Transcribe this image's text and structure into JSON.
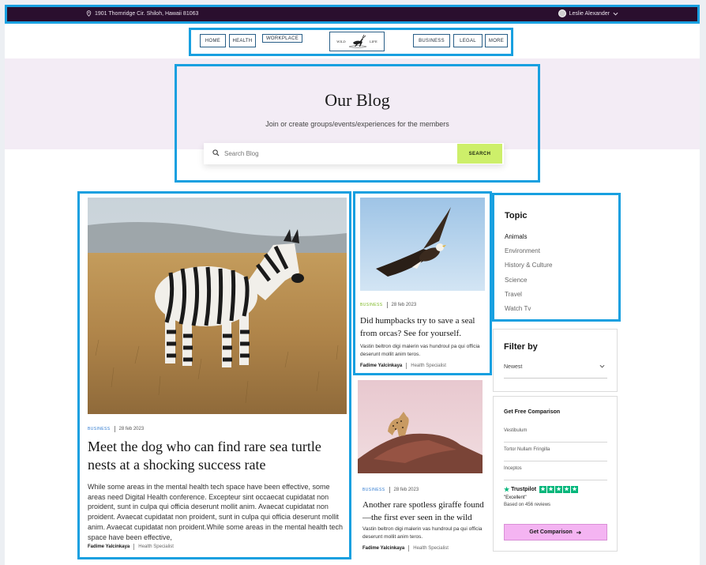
{
  "topbar": {
    "address": "1901 Thornridge Cir. Shiloh, Hawaii 81063",
    "user_name": "Leslie Alexander"
  },
  "nav": {
    "left": [
      "HOME",
      "HEALTH",
      "WORKPLACE"
    ],
    "right": [
      "BUSINESS",
      "LEGAL",
      "MORE"
    ],
    "logo_left": "WILD",
    "logo_right": "LIFE"
  },
  "hero": {
    "title": "Our Blog",
    "subtitle": "Join or create groups/events/experiences for the members",
    "search_placeholder": "Search Blog",
    "search_button": "SEARCH"
  },
  "posts": [
    {
      "category": "BUSINESS",
      "date": "28 feb 2023",
      "title": "Meet the dog who can find rare sea turtle nests at a shocking success rate",
      "excerpt": "While some areas in the mental health tech space have been effective, some areas need Digital Health conference. Excepteur sint occaecat cupidatat non proident, sunt in culpa qui officia deserunt mollit anim. Avaecat cupidatat non proident. Avaecat cupidatat non proident, sunt in culpa qui officia deserunt mollit anim. Avaecat cupidatat non proident.While some areas in the mental health tech space have been effective,",
      "author": "Fadime Yalcinkaya",
      "role": "Health Specialist"
    },
    {
      "category": "BUSINESS",
      "date": "28 feb 2023",
      "title": "Did humpbacks try to save a seal from orcas? See for yourself.",
      "excerpt": "Vastin beltron digi malerin vas hundroul pa qui officia deserunt mollit anim teros.",
      "author": "Fadime Yalcinkaya",
      "role": "Health Specialist"
    },
    {
      "category": "BUSINESS",
      "date": "28 feb 2023",
      "title": "Another rare spotless giraffe found—the first ever seen in the wild",
      "excerpt": "Vastin beltron digi malerin vas hundroul pa qui officia deserunt mollit anim teros.",
      "author": "Fadime Yalcinkaya",
      "role": "Health Specialist"
    }
  ],
  "topics": {
    "heading": "Topic",
    "items": [
      "Animals",
      "Environment",
      "History & Culture",
      "Science",
      "Travel",
      "Watch Tv"
    ]
  },
  "filter": {
    "heading": "Filter by",
    "selected": "Newest"
  },
  "comparison": {
    "heading": "Get Free Comparison",
    "fields": [
      "Vestibulum",
      "Tortor Nullam Fringilla",
      "Inceptos"
    ],
    "trustpilot": "Trustpilot",
    "rating_word": "\"Excellent\"",
    "reviews": "Based on 456 reviews",
    "button": "Get Comparison"
  },
  "colors": {
    "topbar": "#2a0f2e",
    "accent": "#cdef6a",
    "cta": "#f4b4f2",
    "link": "#2f7ad0",
    "trust": "#00b67a"
  }
}
